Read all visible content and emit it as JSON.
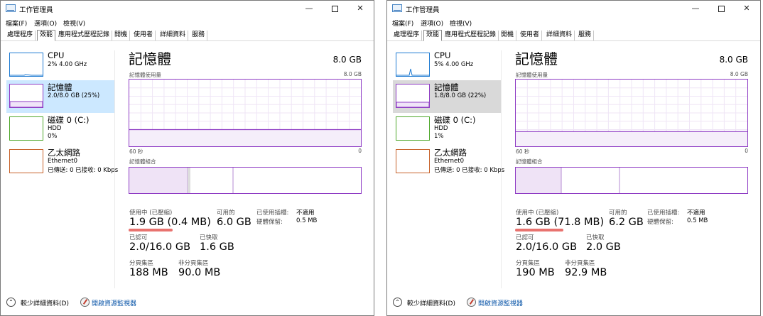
{
  "colors": {
    "memory": "#8e3bc4",
    "cpu": "#1f7bd2",
    "disk": "#4ea72a",
    "ethernet": "#c7622a",
    "link": "#0a55a8",
    "underline": "#e8736f"
  },
  "windows": [
    {
      "title": "工作管理員",
      "menu": [
        "檔案(F)",
        "選項(O)",
        "檢視(V)"
      ],
      "tabs": [
        "處理程序",
        "效能",
        "應用程式歷程記錄",
        "開機",
        "使用者",
        "詳細資料",
        "服務"
      ],
      "active_tab": "效能",
      "sidebar": [
        {
          "title": "CPU",
          "line1": "2%  4.00 GHz",
          "line2": ""
        },
        {
          "title": "記憶體",
          "line1": "2.0/8.0 GB (25%)",
          "line2": "",
          "selected": true
        },
        {
          "title": "磁碟 0 (C:)",
          "line1": "HDD",
          "line2": "0%"
        },
        {
          "title": "乙太網路",
          "line1": "Ethernet0",
          "line2": "已傳送: 0 已接收: 0 Kbps"
        }
      ],
      "main": {
        "title": "記憶體",
        "total": "8.0 GB",
        "usage_label": "記憶體使用量",
        "usage_max": "8.0 GB",
        "axis_left": "60 秒",
        "axis_right": "0",
        "composition_label": "記憶體組合",
        "usage_level": 0.25
      },
      "stats": {
        "in_use_label": "使用中 (已壓縮)",
        "in_use_value": "1.9 GB (0.4 MB)",
        "available_label": "可用的",
        "available_value": "6.0 GB",
        "slots_label": "已使用插槽:",
        "slots_value": "不適用",
        "hw_reserved_label": "硬體保留:",
        "hw_reserved_value": "0.5 MB",
        "committed_label": "已認可",
        "committed_value": "2.0/16.0 GB",
        "cached_label": "已快取",
        "cached_value": "1.6 GB",
        "paged_label": "分頁集區",
        "paged_value": "188 MB",
        "nonpaged_label": "非分頁集區",
        "nonpaged_value": "90.0 MB"
      },
      "footer": {
        "fewer_details": "較少詳細資料(D)",
        "resource_monitor": "開啟資源監視器"
      }
    },
    {
      "title": "工作管理員",
      "menu": [
        "檔案(F)",
        "選項(O)",
        "檢視(V)"
      ],
      "tabs": [
        "處理程序",
        "效能",
        "應用程式歷程記錄",
        "開機",
        "使用者",
        "詳細資料",
        "服務"
      ],
      "active_tab": "效能",
      "sidebar": [
        {
          "title": "CPU",
          "line1": "5%  4.00 GHz",
          "line2": ""
        },
        {
          "title": "記憶體",
          "line1": "1.8/8.0 GB (22%)",
          "line2": "",
          "selected": true
        },
        {
          "title": "磁碟 0 (C:)",
          "line1": "HDD",
          "line2": "1%"
        },
        {
          "title": "乙太網路",
          "line1": "Ethernet0",
          "line2": "已傳送: 0 已接收: 0 Kbps"
        }
      ],
      "main": {
        "title": "記憶體",
        "total": "8.0 GB",
        "usage_label": "記憶體使用量",
        "usage_max": "8.0 GB",
        "axis_left": "60 秒",
        "axis_right": "0",
        "composition_label": "記憶體組合",
        "usage_level": 0.22
      },
      "stats": {
        "in_use_label": "使用中 (已壓縮)",
        "in_use_value": "1.6 GB (71.8 MB)",
        "available_label": "可用的",
        "available_value": "6.2 GB",
        "slots_label": "已使用插槽:",
        "slots_value": "不適用",
        "hw_reserved_label": "硬體保留:",
        "hw_reserved_value": "0.5 MB",
        "committed_label": "已認可",
        "committed_value": "2.0/16.0 GB",
        "cached_label": "已快取",
        "cached_value": "2.0 GB",
        "paged_label": "分頁集區",
        "paged_value": "190 MB",
        "nonpaged_label": "非分頁集區",
        "nonpaged_value": "92.9 MB"
      },
      "footer": {
        "fewer_details": "較少詳細資料(D)",
        "resource_monitor": "開啟資源監視器"
      }
    }
  ]
}
